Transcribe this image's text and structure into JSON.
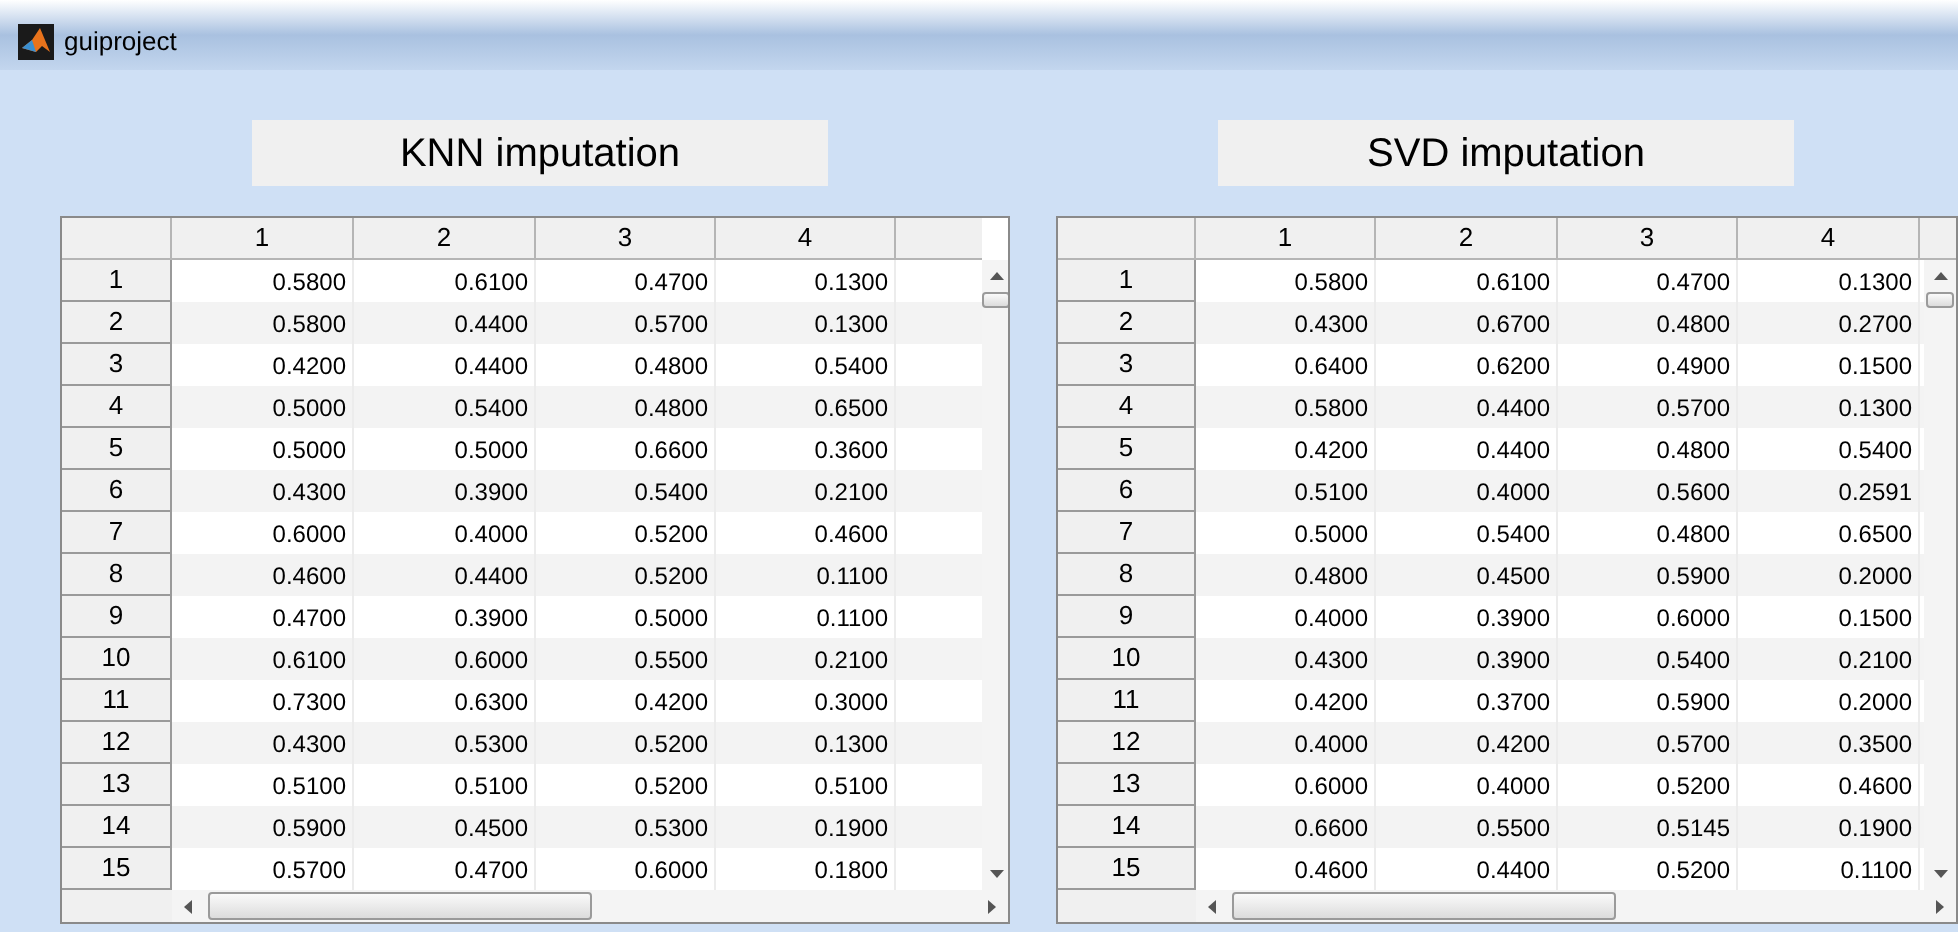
{
  "window": {
    "title": "guiproject"
  },
  "panels": [
    {
      "title": "KNN imputation",
      "table": {
        "columns": [
          "1",
          "2",
          "3",
          "4"
        ],
        "rows": [
          {
            "header": "1",
            "cells": [
              "0.5800",
              "0.6100",
              "0.4700",
              "0.1300"
            ]
          },
          {
            "header": "2",
            "cells": [
              "0.5800",
              "0.4400",
              "0.5700",
              "0.1300"
            ]
          },
          {
            "header": "3",
            "cells": [
              "0.4200",
              "0.4400",
              "0.4800",
              "0.5400"
            ]
          },
          {
            "header": "4",
            "cells": [
              "0.5000",
              "0.5400",
              "0.4800",
              "0.6500"
            ]
          },
          {
            "header": "5",
            "cells": [
              "0.5000",
              "0.5000",
              "0.6600",
              "0.3600"
            ]
          },
          {
            "header": "6",
            "cells": [
              "0.4300",
              "0.3900",
              "0.5400",
              "0.2100"
            ]
          },
          {
            "header": "7",
            "cells": [
              "0.6000",
              "0.4000",
              "0.5200",
              "0.4600"
            ]
          },
          {
            "header": "8",
            "cells": [
              "0.4600",
              "0.4400",
              "0.5200",
              "0.1100"
            ]
          },
          {
            "header": "9",
            "cells": [
              "0.4700",
              "0.3900",
              "0.5000",
              "0.1100"
            ]
          },
          {
            "header": "10",
            "cells": [
              "0.6100",
              "0.6000",
              "0.5500",
              "0.2100"
            ]
          },
          {
            "header": "11",
            "cells": [
              "0.7300",
              "0.6300",
              "0.4200",
              "0.3000"
            ]
          },
          {
            "header": "12",
            "cells": [
              "0.4300",
              "0.5300",
              "0.5200",
              "0.1300"
            ]
          },
          {
            "header": "13",
            "cells": [
              "0.5100",
              "0.5100",
              "0.5200",
              "0.5100"
            ]
          },
          {
            "header": "14",
            "cells": [
              "0.5900",
              "0.4500",
              "0.5300",
              "0.1900"
            ]
          },
          {
            "header": "15",
            "cells": [
              "0.5700",
              "0.4700",
              "0.6000",
              "0.1800"
            ]
          }
        ]
      }
    },
    {
      "title": "SVD imputation",
      "table": {
        "columns": [
          "1",
          "2",
          "3",
          "4"
        ],
        "rows": [
          {
            "header": "1",
            "cells": [
              "0.5800",
              "0.6100",
              "0.4700",
              "0.1300"
            ]
          },
          {
            "header": "2",
            "cells": [
              "0.4300",
              "0.6700",
              "0.4800",
              "0.2700"
            ]
          },
          {
            "header": "3",
            "cells": [
              "0.6400",
              "0.6200",
              "0.4900",
              "0.1500"
            ]
          },
          {
            "header": "4",
            "cells": [
              "0.5800",
              "0.4400",
              "0.5700",
              "0.1300"
            ]
          },
          {
            "header": "5",
            "cells": [
              "0.4200",
              "0.4400",
              "0.4800",
              "0.5400"
            ]
          },
          {
            "header": "6",
            "cells": [
              "0.5100",
              "0.4000",
              "0.5600",
              "0.2591"
            ]
          },
          {
            "header": "7",
            "cells": [
              "0.5000",
              "0.5400",
              "0.4800",
              "0.6500"
            ]
          },
          {
            "header": "8",
            "cells": [
              "0.4800",
              "0.4500",
              "0.5900",
              "0.2000"
            ]
          },
          {
            "header": "9",
            "cells": [
              "0.4000",
              "0.3900",
              "0.6000",
              "0.1500"
            ]
          },
          {
            "header": "10",
            "cells": [
              "0.4300",
              "0.3900",
              "0.5400",
              "0.2100"
            ]
          },
          {
            "header": "11",
            "cells": [
              "0.4200",
              "0.3700",
              "0.5900",
              "0.2000"
            ]
          },
          {
            "header": "12",
            "cells": [
              "0.4000",
              "0.4200",
              "0.5700",
              "0.3500"
            ]
          },
          {
            "header": "13",
            "cells": [
              "0.6000",
              "0.4000",
              "0.5200",
              "0.4600"
            ]
          },
          {
            "header": "14",
            "cells": [
              "0.6600",
              "0.5500",
              "0.5145",
              "0.1900"
            ]
          },
          {
            "header": "15",
            "cells": [
              "0.4600",
              "0.4400",
              "0.5200",
              "0.1100"
            ]
          }
        ]
      }
    }
  ]
}
